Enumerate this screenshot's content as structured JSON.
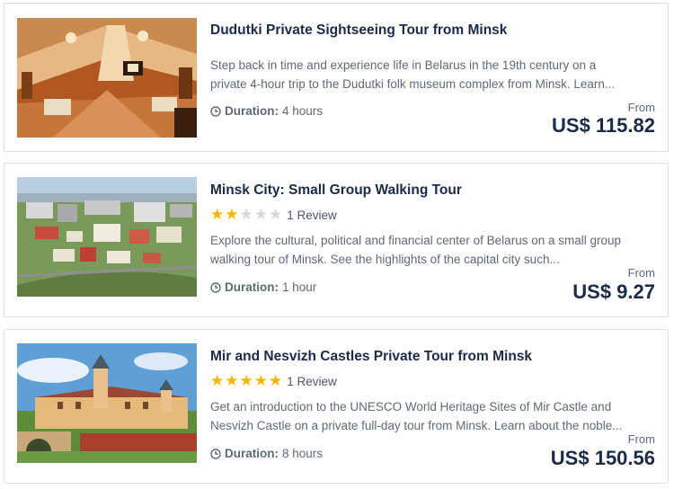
{
  "tours": [
    {
      "title": "Dudutki Private Sightseeing Tour from Minsk",
      "description_lines": [
        "Step back in time and experience life in Belarus in the 19th century on a",
        "private 4-hour trip to the Dudutki folk museum complex from Minsk. Learn..."
      ],
      "duration_label": "Duration:",
      "duration_value": "4 hours",
      "price_prefix": "From",
      "price": "US$ 115.82",
      "image_icon": "museum-interior-photo"
    },
    {
      "title": "Minsk City: Small Group Walking Tour",
      "rating": 2,
      "rating_max": 5,
      "review_text": "1 Review",
      "description_lines": [
        "Explore the cultural, political and financial center of Belarus on a small group",
        "walking tour of Minsk. See the highlights of the capital city such..."
      ],
      "duration_label": "Duration:",
      "duration_value": "1 hour",
      "price_prefix": "From",
      "price": "US$ 9.27",
      "image_icon": "city-aerial-photo"
    },
    {
      "title": "Mir and Nesvizh Castles Private Tour from Minsk",
      "rating": 5,
      "rating_max": 5,
      "review_text": "1 Review",
      "description_lines": [
        "Get an introduction to the UNESCO World Heritage Sites of Mir Castle and",
        "Nesvizh Castle on a private full-day tour from Minsk. Learn about the noble..."
      ],
      "duration_label": "Duration:",
      "duration_value": "8 hours",
      "price_prefix": "From",
      "price": "US$ 150.56",
      "image_icon": "castle-photo"
    }
  ],
  "colors": {
    "title": "#1a2b49",
    "text": "#5e6978",
    "star_on": "#f7b500",
    "star_off": "#d7d7d7",
    "border": "#dcdfe6"
  }
}
